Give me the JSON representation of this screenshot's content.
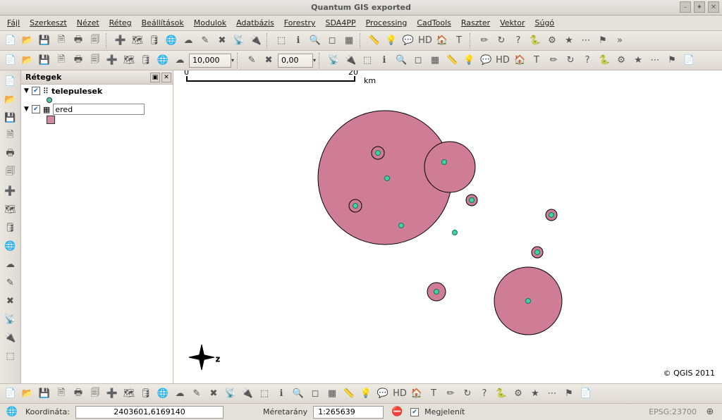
{
  "window": {
    "title": "Quantum GIS exported"
  },
  "winbuttons": {
    "min": "–",
    "max": "✦",
    "close": "✕"
  },
  "menu": [
    "Fájl",
    "Szerkeszt",
    "Nézet",
    "Réteg",
    "Beállítások",
    "Modulok",
    "Adatbázis",
    "Forestry",
    "SDA4PP",
    "Processing",
    "CadTools",
    "Raszter",
    "Vektor",
    "Súgó"
  ],
  "toolbar1_icons": [
    "file-new-icon",
    "file-open-icon",
    "save-icon",
    "save-as-icon",
    "print-icon",
    "composer-icon",
    "add-vector-icon",
    "add-raster-icon",
    "add-postgis-icon",
    "add-spatialite-icon",
    "add-wms-icon",
    "new-shapefile-icon",
    "remove-layer-icon",
    "gps-icon",
    "plugin-icon",
    "select-icon",
    "info-icon",
    "identify-icon",
    "deselect-icon",
    "table-icon",
    "measure-icon",
    "tips-icon",
    "speech-icon",
    "hd-icon",
    "home-icon",
    "text-icon",
    "annotation-icon",
    "refresh-icon",
    "help-icon",
    "python-icon",
    "ext1-icon",
    "ext2-icon",
    "ext3-icon",
    "options-icon"
  ],
  "toolbar2": {
    "icons_a": [
      "edit-icon",
      "save-edits-icon",
      "cut-icon",
      "copy-icon",
      "paste-icon",
      "undo-icon",
      "redo-icon",
      "move-icon",
      "node-icon",
      "rotate-icon",
      "delete-icon"
    ],
    "input1": "10,000",
    "icons_b": [
      "merge-icon",
      "split-icon"
    ],
    "input2": "0,00",
    "icons_c": [
      "reshape-icon",
      "offset-icon",
      "simplify-icon",
      "addring-icon",
      "addpart-icon",
      "delring-icon",
      "delpart-icon",
      "fill-icon",
      "trace-icon",
      "snap-icon",
      "plus1-icon",
      "plus2-icon",
      "plus3-icon",
      "plus4-icon",
      "chev-icon",
      "globe1-icon",
      "globe2-icon",
      "globe3-icon",
      "chev2-icon",
      "graph1-icon",
      "graph2-icon",
      "graph3-icon"
    ]
  },
  "left_icons": [
    "pan-icon",
    "zoomin-icon",
    "zoomout-icon",
    "zoomfull-icon",
    "zoomsel-icon",
    "zoomlayer-icon",
    "zoomlast-icon",
    "zoomnext-icon",
    "refresh2-icon",
    "crs-icon",
    "bookmark-icon",
    "abc-icon",
    "label-icon",
    "style-icon",
    "ruler-icon",
    "prefs-icon"
  ],
  "layers": {
    "panel_title": "Rétegek",
    "items": [
      {
        "name": "telepulesek",
        "checked": true,
        "editable": false,
        "symbol": "dot"
      },
      {
        "name": "ered",
        "checked": true,
        "editable": true,
        "symbol": "square"
      }
    ]
  },
  "scalebar": {
    "left": "0",
    "right": "20",
    "unit": "km"
  },
  "copyright": "© QGIS 2011",
  "bottom_icons": [
    "b-globe-icon",
    "b-wave-icon",
    "b-d2s-icon",
    "b-green1-icon",
    "b-green2-icon",
    "b-db-icon",
    "b-ruler-icon",
    "b-layers-icon",
    "b-chart-icon",
    "b-north-icon",
    "b-print-icon",
    "b-gear-icon",
    "b-mag-icon",
    "b-mail-icon",
    "b-v-icon",
    "b-blob-icon",
    "b-x-icon",
    "b-grid-icon",
    "b-sigma-icon",
    "b-cog-icon",
    "b-doc-icon",
    "b-edit-icon",
    "b-note-icon",
    "b-py-icon",
    "b-sq-icon",
    "b-star-icon",
    "b-p2-icon",
    "b-arrow-icon",
    "b-pdf-icon",
    "b-calc-icon",
    "b-win-icon",
    "b-pg-icon",
    "b-sql-icon",
    "b-tree-icon",
    "b-world-icon"
  ],
  "status": {
    "coord_label": "Koordináta:",
    "coord_value": "2403601,6169140",
    "scale_label": "Méretarány",
    "scale_value": "1:265639",
    "render_label": "Megjelenít",
    "epsg": "EPSG:23700"
  }
}
